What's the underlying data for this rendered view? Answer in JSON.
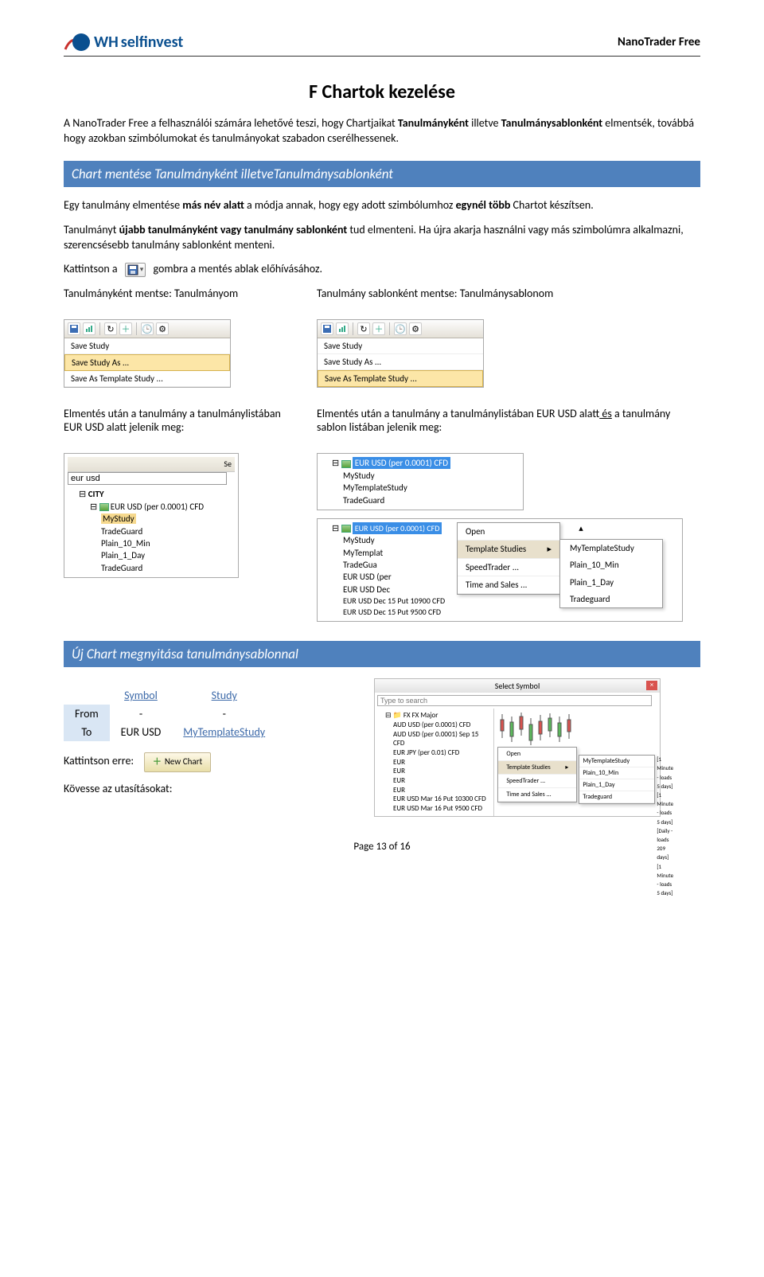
{
  "header": {
    "logo_text_prefix": "WH",
    "logo_text": "selfinvest",
    "doc_title": "NanoTrader Free"
  },
  "title": "F Chartok kezelése",
  "intro": {
    "p1_a": "A NanoTrader Free a felhasználói számára lehetővé teszi, hogy Chartjaikat ",
    "p1_b": "Tanulmányként",
    "p1_c": " illetve ",
    "p1_d": "Tanulmánysablonként",
    "p1_e": " elmentsék, továbbá hogy azokban szimbólumokat és tanulmányokat szabadon cserélhessenek."
  },
  "section1": {
    "bar": "Chart mentése Tanulmányként illetveTanulmánysablonként",
    "p1_a": "Egy tanulmány elmentése ",
    "p1_b": "más név alatt",
    "p1_c": " a módja annak, hogy egy adott szimbólumhoz ",
    "p1_d": "egynél több",
    "p1_e": " Chartot készítsen.",
    "p2_a": "Tanulmányt ",
    "p2_b": "újabb tanulmányként vagy tanulmány sablonként",
    "p2_c": " tud elmenteni. Ha újra akarja használni vagy más szimbolúmra alkalmazni, szerencsésebb tanulmány sablonként menteni.",
    "p3_a": "Kattintson a",
    "p3_b": "gombra a mentés ablak előhívásához.",
    "left_label": "Tanulmányként mentse: Tanulmányom",
    "right_label": "Tanulmány sablonként mentse: Tanulmánysablonom",
    "menu_items": [
      "Save Study",
      "Save Study As ...",
      "Save As Template Study ..."
    ],
    "after_left": "Elmentés után a tanulmány a tanulmánylistában EUR USD alatt jelenik meg:",
    "after_right_a": "Elmentés után a tanulmány a tanulmánylistában EUR USD alatt",
    "after_right_b": " és a tanulmány sablon listában jelenik meg:",
    "tree_left": {
      "search": "eur usd",
      "root": "CITY",
      "instr": "EUR USD (per 0.0001) CFD",
      "items": [
        "MyStudy",
        "TradeGuard",
        "Plain_10_Min",
        "Plain_1_Day",
        "TradeGuard"
      ]
    },
    "tree_right_top": {
      "instr": "EUR USD (per 0.0001) CFD",
      "items": [
        "MyStudy",
        "MyTemplateStudy",
        "TradeGuard"
      ]
    },
    "tree_right_bottom": {
      "instr_hl": "EUR USD (per 0.0001) CFD",
      "items_left": [
        "MyStudy",
        "MyTemplat",
        "TradeGua",
        "EUR USD (per",
        "EUR USD Dec",
        "EUR USD Dec 15 Put 10900 CFD",
        "EUR USD Dec 15 Put 9500 CFD"
      ],
      "ctx": [
        "Open",
        "Template Studies",
        "SpeedTrader ...",
        "Time and Sales ..."
      ],
      "ctx_sel_index": 1,
      "fly": [
        "MyTemplateStudy",
        "Plain_10_Min",
        "Plain_1_Day",
        "Tradeguard"
      ]
    }
  },
  "section2": {
    "bar": "Új Chart megnyitása tanulmánysablonnal",
    "table": {
      "h_symbol": "Symbol",
      "h_study": "Study",
      "r_from": "From",
      "r_to": "To",
      "from_sym": "-",
      "from_study": "-",
      "to_sym": "EUR USD",
      "to_study": "MyTemplateStudy"
    },
    "click_label": "Kattintson erre:",
    "btn_label": "New Chart",
    "follow": "Kövesse az utasításokat:",
    "dialog": {
      "title": "Select Symbol",
      "search_ph": "Type to search",
      "root": "FX FX Major",
      "rows": [
        "AUD USD (per 0.0001) CFD",
        "AUD USD (per 0.0001) Sep 15 CFD",
        "EUR JPY (per 0.01) CFD"
      ],
      "eur_hl": "EUR",
      "extra_rows": [
        "EUR",
        "EUR",
        "EUR",
        "EUR USD Mar 16 Put 10300 CFD",
        "EUR USD Mar 16 Put 9500 CFD"
      ],
      "ctx": [
        "Open",
        "Template Studies",
        "SpeedTrader ...",
        "Time and Sales ..."
      ],
      "fly_col1": [
        "MyTemplateStudy",
        "Plain_10_Min",
        "Plain_1_Day",
        "Tradeguard"
      ],
      "fly_col2": [
        "[1 Minute - loads 5 days]",
        "[1 Minute - loads 5 days]",
        "[Daily - loads 209 days]",
        "[1 Minute - loads 5 days]"
      ]
    }
  },
  "footer": "Page 13 of 16"
}
